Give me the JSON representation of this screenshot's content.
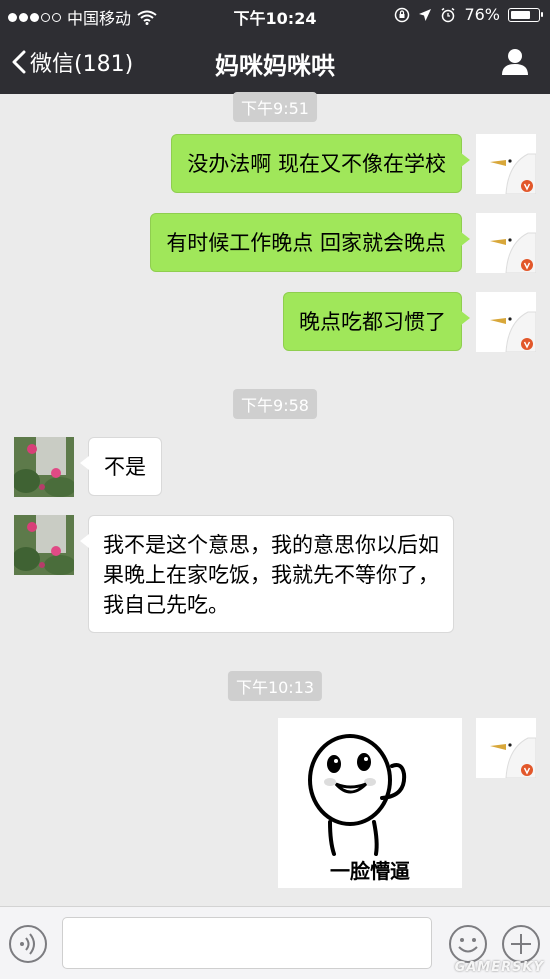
{
  "status_bar": {
    "carrier": "中国移动",
    "time": "下午10:24",
    "battery": "76%",
    "battery_level": 0.76
  },
  "nav": {
    "back_label": "微信(181)",
    "title": "妈咪妈咪哄",
    "profile_icon": "person-icon"
  },
  "messages": {
    "ts0": "下午9:51",
    "m1": "没办法啊 现在又不像在学校",
    "m2": "有时候工作晚点 回家就会晚点",
    "m3": "晚点吃都习惯了",
    "ts1": "下午9:58",
    "m4": "不是",
    "m5": "我不是这个意思，我的意思你以后如果晚上在家吃饭，我就先不等你了，我自己先吃。",
    "ts2": "下午10:13",
    "sticker_caption": "一脸懵逼"
  },
  "input_bar": {
    "placeholder": "",
    "voice_icon": "voice-icon",
    "emoji_icon": "emoji-icon",
    "plus_icon": "plus-icon"
  },
  "watermark": "GAMERSKY",
  "colors": {
    "header_bg": "#2e2e33",
    "sent_bubble": "#a0e75a",
    "chat_bg": "#ebebeb"
  }
}
